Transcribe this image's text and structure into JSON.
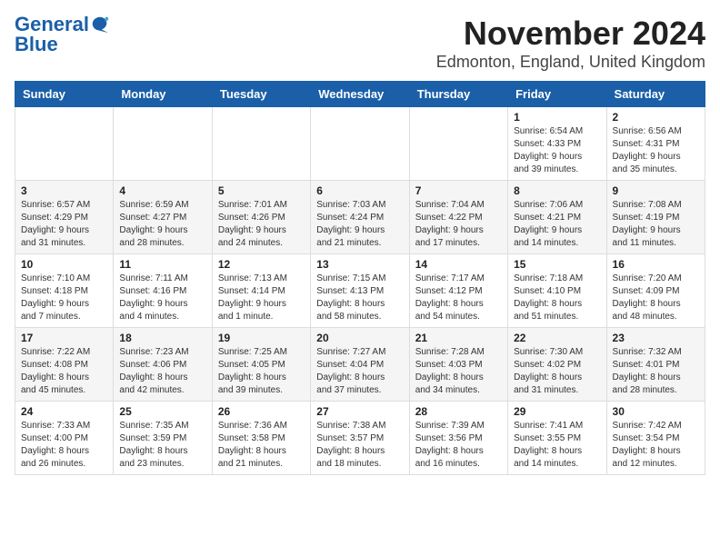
{
  "header": {
    "logo_general": "General",
    "logo_blue": "Blue",
    "title": "November 2024",
    "subtitle": "Edmonton, England, United Kingdom"
  },
  "weekdays": [
    "Sunday",
    "Monday",
    "Tuesday",
    "Wednesday",
    "Thursday",
    "Friday",
    "Saturday"
  ],
  "weeks": [
    [
      {
        "day": "",
        "info": ""
      },
      {
        "day": "",
        "info": ""
      },
      {
        "day": "",
        "info": ""
      },
      {
        "day": "",
        "info": ""
      },
      {
        "day": "",
        "info": ""
      },
      {
        "day": "1",
        "info": "Sunrise: 6:54 AM\nSunset: 4:33 PM\nDaylight: 9 hours\nand 39 minutes."
      },
      {
        "day": "2",
        "info": "Sunrise: 6:56 AM\nSunset: 4:31 PM\nDaylight: 9 hours\nand 35 minutes."
      }
    ],
    [
      {
        "day": "3",
        "info": "Sunrise: 6:57 AM\nSunset: 4:29 PM\nDaylight: 9 hours\nand 31 minutes."
      },
      {
        "day": "4",
        "info": "Sunrise: 6:59 AM\nSunset: 4:27 PM\nDaylight: 9 hours\nand 28 minutes."
      },
      {
        "day": "5",
        "info": "Sunrise: 7:01 AM\nSunset: 4:26 PM\nDaylight: 9 hours\nand 24 minutes."
      },
      {
        "day": "6",
        "info": "Sunrise: 7:03 AM\nSunset: 4:24 PM\nDaylight: 9 hours\nand 21 minutes."
      },
      {
        "day": "7",
        "info": "Sunrise: 7:04 AM\nSunset: 4:22 PM\nDaylight: 9 hours\nand 17 minutes."
      },
      {
        "day": "8",
        "info": "Sunrise: 7:06 AM\nSunset: 4:21 PM\nDaylight: 9 hours\nand 14 minutes."
      },
      {
        "day": "9",
        "info": "Sunrise: 7:08 AM\nSunset: 4:19 PM\nDaylight: 9 hours\nand 11 minutes."
      }
    ],
    [
      {
        "day": "10",
        "info": "Sunrise: 7:10 AM\nSunset: 4:18 PM\nDaylight: 9 hours\nand 7 minutes."
      },
      {
        "day": "11",
        "info": "Sunrise: 7:11 AM\nSunset: 4:16 PM\nDaylight: 9 hours\nand 4 minutes."
      },
      {
        "day": "12",
        "info": "Sunrise: 7:13 AM\nSunset: 4:14 PM\nDaylight: 9 hours\nand 1 minute."
      },
      {
        "day": "13",
        "info": "Sunrise: 7:15 AM\nSunset: 4:13 PM\nDaylight: 8 hours\nand 58 minutes."
      },
      {
        "day": "14",
        "info": "Sunrise: 7:17 AM\nSunset: 4:12 PM\nDaylight: 8 hours\nand 54 minutes."
      },
      {
        "day": "15",
        "info": "Sunrise: 7:18 AM\nSunset: 4:10 PM\nDaylight: 8 hours\nand 51 minutes."
      },
      {
        "day": "16",
        "info": "Sunrise: 7:20 AM\nSunset: 4:09 PM\nDaylight: 8 hours\nand 48 minutes."
      }
    ],
    [
      {
        "day": "17",
        "info": "Sunrise: 7:22 AM\nSunset: 4:08 PM\nDaylight: 8 hours\nand 45 minutes."
      },
      {
        "day": "18",
        "info": "Sunrise: 7:23 AM\nSunset: 4:06 PM\nDaylight: 8 hours\nand 42 minutes."
      },
      {
        "day": "19",
        "info": "Sunrise: 7:25 AM\nSunset: 4:05 PM\nDaylight: 8 hours\nand 39 minutes."
      },
      {
        "day": "20",
        "info": "Sunrise: 7:27 AM\nSunset: 4:04 PM\nDaylight: 8 hours\nand 37 minutes."
      },
      {
        "day": "21",
        "info": "Sunrise: 7:28 AM\nSunset: 4:03 PM\nDaylight: 8 hours\nand 34 minutes."
      },
      {
        "day": "22",
        "info": "Sunrise: 7:30 AM\nSunset: 4:02 PM\nDaylight: 8 hours\nand 31 minutes."
      },
      {
        "day": "23",
        "info": "Sunrise: 7:32 AM\nSunset: 4:01 PM\nDaylight: 8 hours\nand 28 minutes."
      }
    ],
    [
      {
        "day": "24",
        "info": "Sunrise: 7:33 AM\nSunset: 4:00 PM\nDaylight: 8 hours\nand 26 minutes."
      },
      {
        "day": "25",
        "info": "Sunrise: 7:35 AM\nSunset: 3:59 PM\nDaylight: 8 hours\nand 23 minutes."
      },
      {
        "day": "26",
        "info": "Sunrise: 7:36 AM\nSunset: 3:58 PM\nDaylight: 8 hours\nand 21 minutes."
      },
      {
        "day": "27",
        "info": "Sunrise: 7:38 AM\nSunset: 3:57 PM\nDaylight: 8 hours\nand 18 minutes."
      },
      {
        "day": "28",
        "info": "Sunrise: 7:39 AM\nSunset: 3:56 PM\nDaylight: 8 hours\nand 16 minutes."
      },
      {
        "day": "29",
        "info": "Sunrise: 7:41 AM\nSunset: 3:55 PM\nDaylight: 8 hours\nand 14 minutes."
      },
      {
        "day": "30",
        "info": "Sunrise: 7:42 AM\nSunset: 3:54 PM\nDaylight: 8 hours\nand 12 minutes."
      }
    ]
  ]
}
